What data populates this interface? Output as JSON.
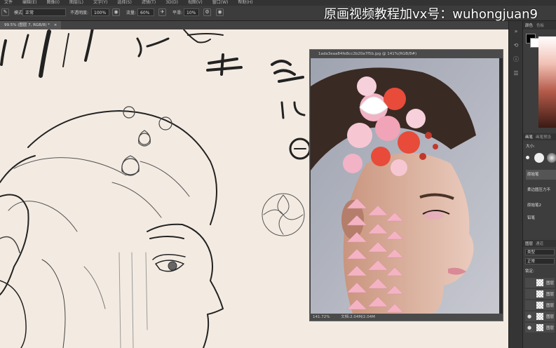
{
  "menubar": {
    "items": [
      "文件",
      "编辑(E)",
      "图像(I)",
      "图层(L)",
      "文字(Y)",
      "选择(S)",
      "滤镜(T)",
      "3D(D)",
      "视图(V)",
      "窗口(W)",
      "帮助(H)"
    ]
  },
  "options": {
    "mode_label": "模式:",
    "mode_value": "正常",
    "opacity_label": "不透明度:",
    "opacity_value": "100%",
    "flow_label": "流量:",
    "flow_value": "60%",
    "smooth_label": "平滑:",
    "smooth_value": "10%"
  },
  "watermark": "原画视频教程加vx号：wuhongjuan9",
  "document_tab": "99.5% (图层 7, RGB/8) *",
  "photo_window": {
    "title": "1ada3eaa84fe8cc2b20a7f5b.jpg @ 141%(RGB/8#)",
    "zoom": "141.72%",
    "doc_info": "文档:2.04M/2.04M"
  },
  "panels": {
    "color_tabs": [
      "颜色",
      "色板"
    ],
    "brush_tabs": [
      "画笔",
      "画笔预设"
    ],
    "size_label": "大小:",
    "brushes": [
      "原始笔",
      "柔边圆压力不",
      "原始笔2",
      "铅笔"
    ],
    "layers_tabs": [
      "图层",
      "通道"
    ],
    "layer_filter": "类型",
    "blend_mode": "正常",
    "lock_label": "锁定:",
    "layer_names": [
      "图层",
      "图层",
      "图层",
      "图层",
      "图层"
    ]
  },
  "colors": {
    "foreground": "#000000",
    "background": "#ffffff",
    "canvas": "#f3ebe2",
    "accent_red": "#c0392b"
  }
}
